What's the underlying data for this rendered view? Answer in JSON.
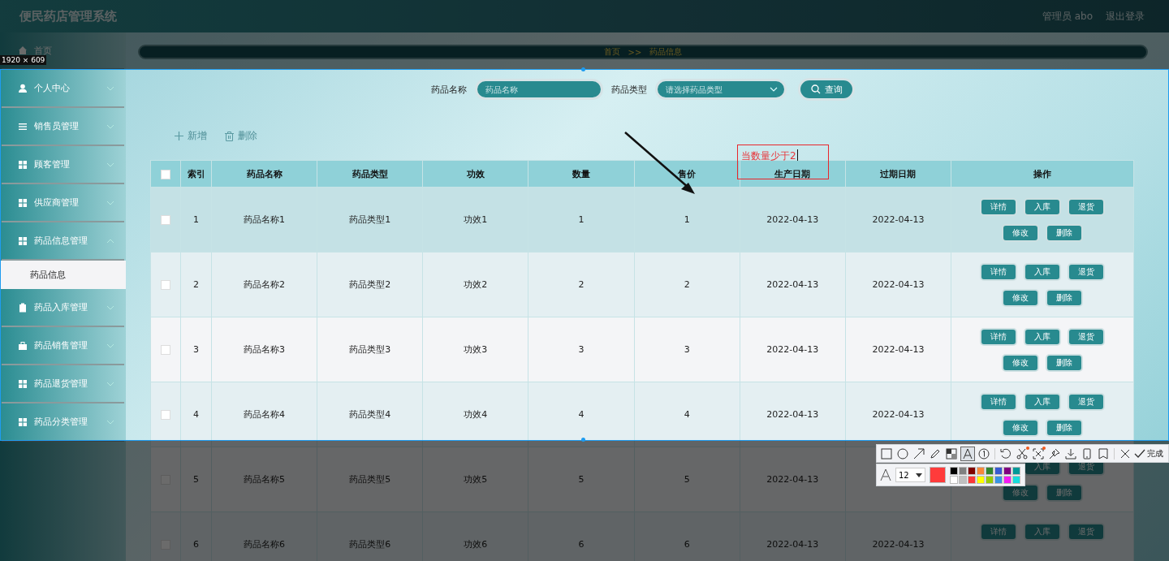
{
  "header": {
    "title": "便民药店管理系统",
    "user": "管理员 abo",
    "logout": "退出登录"
  },
  "sidebar": {
    "items": [
      {
        "label": "首页",
        "kind": "home"
      },
      {
        "label": "个人中心",
        "kind": "user",
        "expanded": false
      },
      {
        "label": "销售员管理",
        "kind": "list",
        "expanded": false
      },
      {
        "label": "顾客管理",
        "kind": "grid",
        "expanded": false
      },
      {
        "label": "供应商管理",
        "kind": "grid",
        "expanded": false
      },
      {
        "label": "药品信息管理",
        "kind": "grid",
        "expanded": true,
        "children": [
          {
            "label": "药品信息",
            "selected": true
          }
        ]
      },
      {
        "label": "药品入库管理",
        "kind": "clipboard",
        "expanded": false
      },
      {
        "label": "药品销售管理",
        "kind": "briefcase",
        "expanded": false
      },
      {
        "label": "药品退货管理",
        "kind": "grid",
        "expanded": false
      },
      {
        "label": "药品分类管理",
        "kind": "grid",
        "expanded": false
      }
    ]
  },
  "breadcrumb": {
    "home": "首页",
    "separator": ">>",
    "current": "药品信息"
  },
  "search": {
    "fields": [
      {
        "kind": "input",
        "label": "药品名称",
        "placeholder": "药品名称"
      },
      {
        "kind": "select",
        "label": "药品类型",
        "placeholder": "请选择药品类型"
      }
    ],
    "button": "查询"
  },
  "actions": [
    {
      "kind": "add",
      "label": "新增"
    },
    {
      "kind": "delete",
      "label": "删除"
    }
  ],
  "table": {
    "select_all": {
      "checked": false
    },
    "columns": [
      "索引",
      "药品名称",
      "药品类型",
      "功效",
      "数量",
      "售价",
      "生产日期",
      "过期日期",
      "操作"
    ],
    "rows": [
      {
        "checked": false,
        "hovered": true,
        "cells": [
          "1",
          "药品名称1",
          "药品类型1",
          "功效1",
          "1",
          "1",
          "2022-04-13",
          "2022-04-13"
        ],
        "actions": [
          "详情",
          "入库",
          "退货",
          "修改",
          "删除"
        ]
      },
      {
        "checked": false,
        "hovered": false,
        "cells": [
          "2",
          "药品名称2",
          "药品类型2",
          "功效2",
          "2",
          "2",
          "2022-04-13",
          "2022-04-13"
        ],
        "actions": [
          "详情",
          "入库",
          "退货",
          "修改",
          "删除"
        ]
      },
      {
        "checked": false,
        "hovered": false,
        "cells": [
          "3",
          "药品名称3",
          "药品类型3",
          "功效3",
          "3",
          "3",
          "2022-04-13",
          "2022-04-13"
        ],
        "actions": [
          "详情",
          "入库",
          "退货",
          "修改",
          "删除"
        ]
      },
      {
        "checked": false,
        "hovered": false,
        "cells": [
          "4",
          "药品名称4",
          "药品类型4",
          "功效4",
          "4",
          "4",
          "2022-04-13",
          "2022-04-13"
        ],
        "actions": [
          "详情",
          "入库",
          "退货",
          "修改",
          "删除"
        ]
      },
      {
        "checked": false,
        "hovered": false,
        "cells": [
          "5",
          "药品名称5",
          "药品类型5",
          "功效5",
          "5",
          "5",
          "2022-04-13"
        ],
        "actions": [
          "入库",
          "退货",
          "修改",
          "删除"
        ]
      },
      {
        "checked": false,
        "hovered": false,
        "cells": [
          "6",
          "药品名称6",
          "药品类型6",
          "功效6",
          "6",
          "6",
          "2022-04-13",
          "2022-04-13"
        ],
        "actions": [
          "详情",
          "入库",
          "退货"
        ]
      }
    ]
  },
  "capture": {
    "size_label": "1920 × 609",
    "annotation": "当数量少于2",
    "tools": [
      {
        "kind": "rectangle",
        "selected": false,
        "dot": false
      },
      {
        "kind": "ellipse",
        "selected": false,
        "dot": false
      },
      {
        "kind": "arrow",
        "selected": false,
        "dot": false
      },
      {
        "kind": "pencil",
        "selected": false,
        "dot": false
      },
      {
        "kind": "mosaic",
        "selected": false,
        "dot": false
      },
      {
        "kind": "text",
        "selected": true,
        "dot": false
      },
      {
        "kind": "number",
        "selected": false,
        "dot": false
      },
      {
        "kind": "separator"
      },
      {
        "kind": "undo",
        "selected": false,
        "dot": false
      },
      {
        "kind": "scissors",
        "selected": false,
        "dot": true
      },
      {
        "kind": "scan",
        "selected": false,
        "dot": true
      },
      {
        "kind": "pin",
        "selected": false,
        "dot": false
      },
      {
        "kind": "download",
        "selected": false,
        "dot": false
      },
      {
        "kind": "phone",
        "selected": false,
        "dot": false
      },
      {
        "kind": "bookmark",
        "selected": false,
        "dot": false
      },
      {
        "kind": "separator"
      },
      {
        "kind": "close",
        "selected": false,
        "dot": false
      }
    ],
    "done": "完成",
    "font_size": "12",
    "current_swatch": {
      "color": "#ff3b3b"
    },
    "palette": [
      {
        "color": "#000000"
      },
      {
        "color": "#808080"
      },
      {
        "color": "#800000"
      },
      {
        "color": "#f7883a"
      },
      {
        "color": "#308430"
      },
      {
        "color": "#385ad3"
      },
      {
        "color": "#800080"
      },
      {
        "color": "#009999"
      },
      {
        "color": "#ffffff"
      },
      {
        "color": "#c0c0c0"
      },
      {
        "color": "#fb3838"
      },
      {
        "color": "#ffff00"
      },
      {
        "color": "#99cc00"
      },
      {
        "color": "#3894e4"
      },
      {
        "color": "#f31bf3"
      },
      {
        "color": "#16dcdc"
      }
    ]
  }
}
